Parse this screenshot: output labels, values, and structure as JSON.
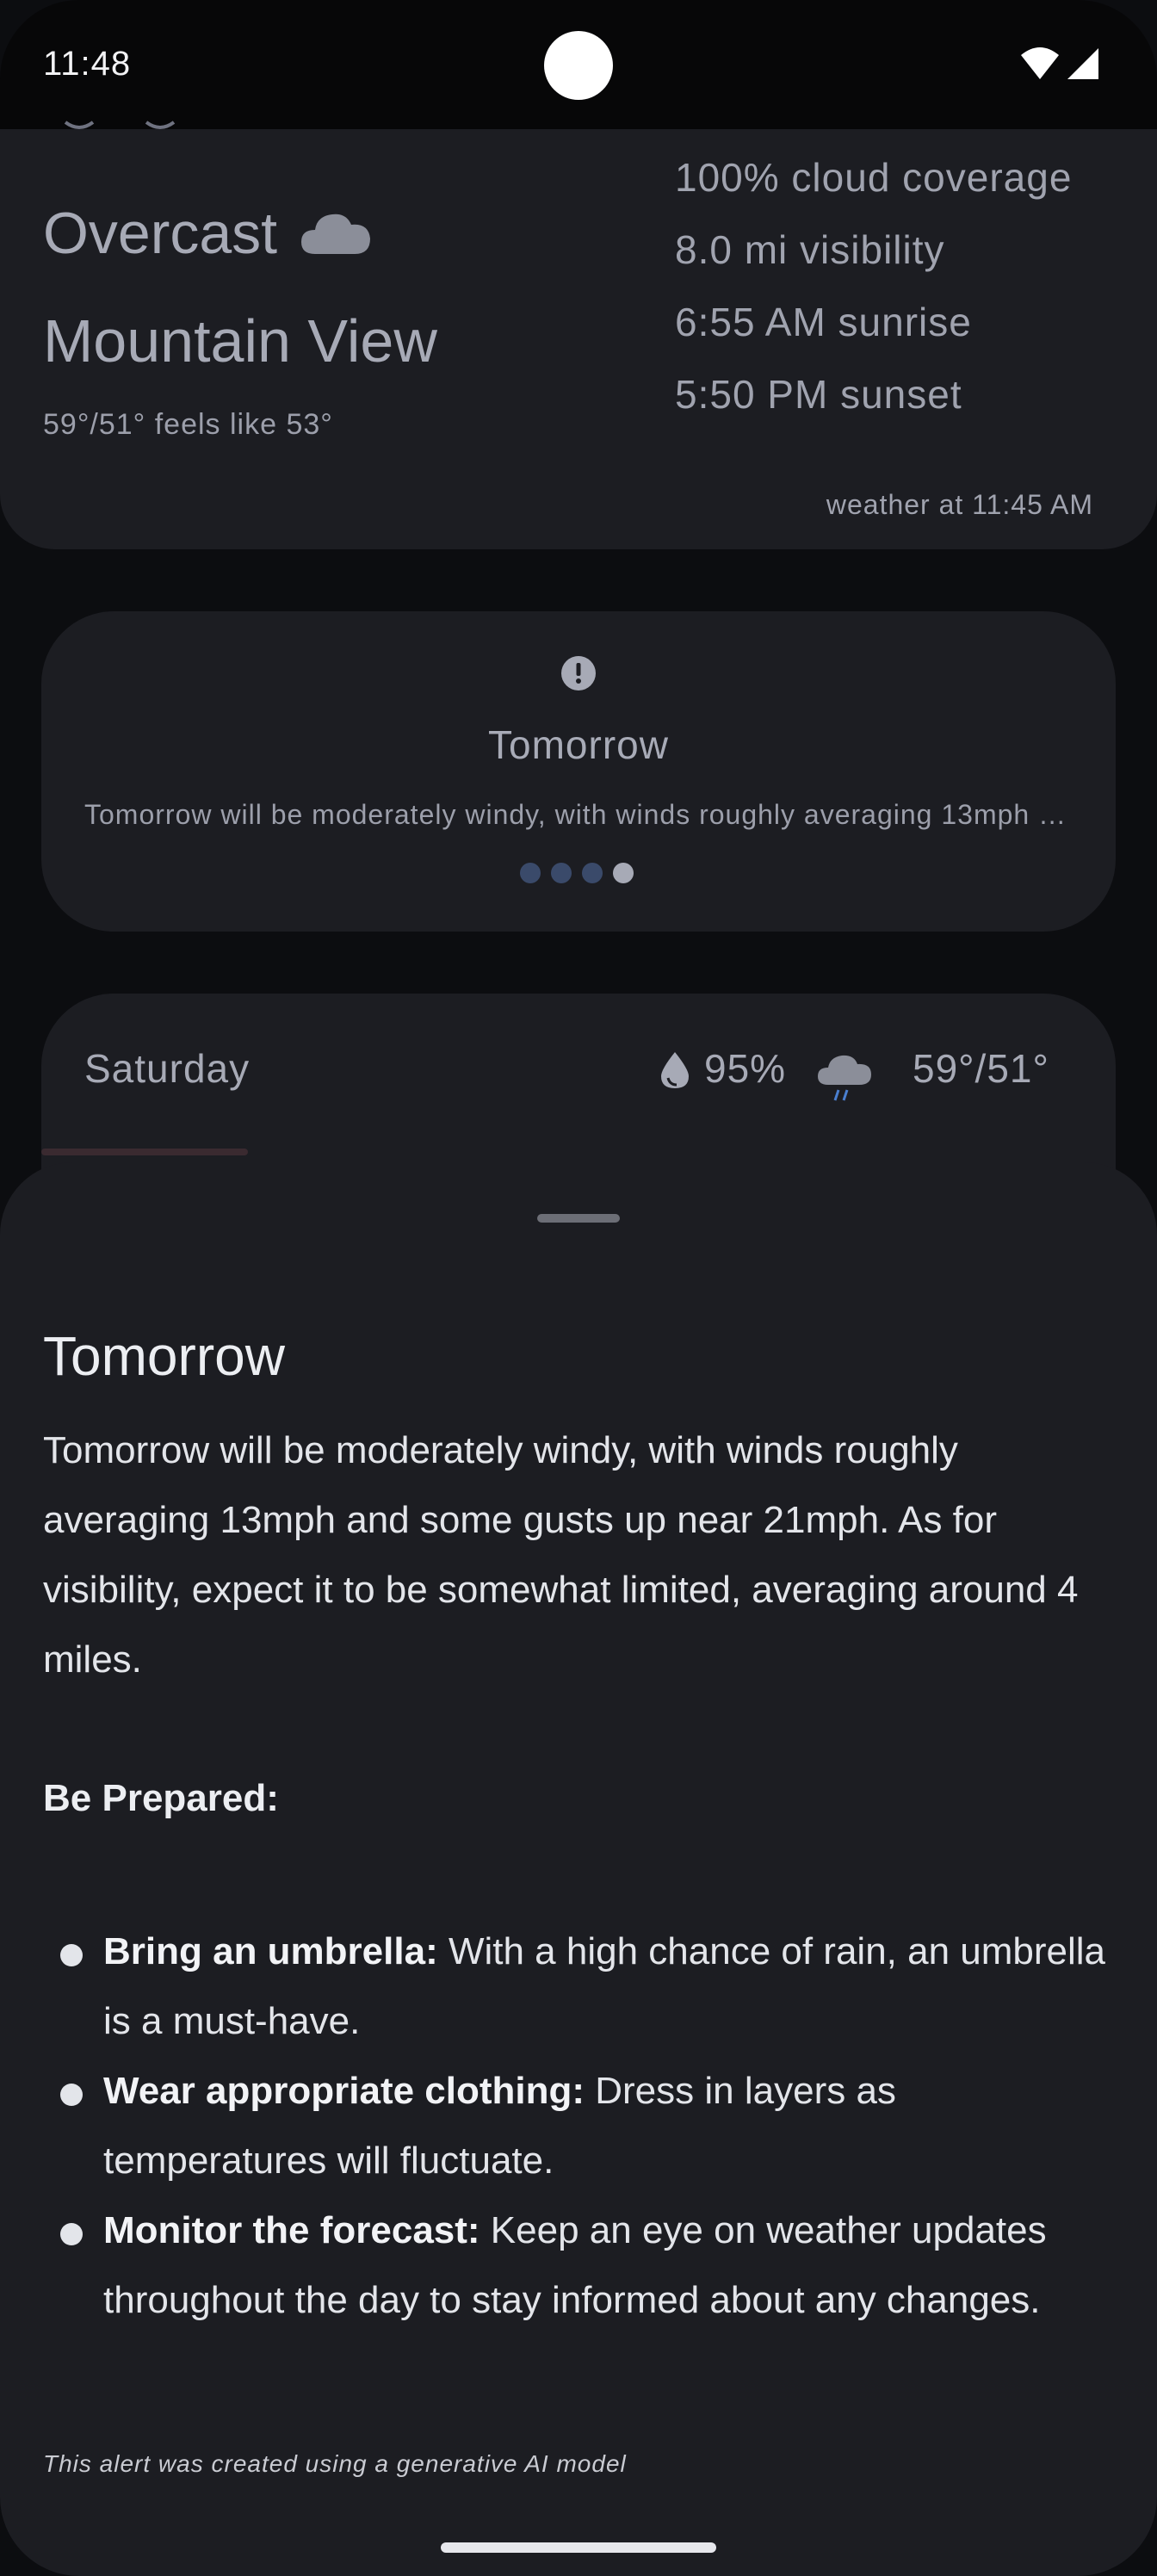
{
  "status_bar": {
    "time": "11:48",
    "icons": [
      "wifi-icon",
      "cellular-signal-icon"
    ]
  },
  "current_weather": {
    "condition": "Overcast",
    "condition_icon": "cloud-icon",
    "city": "Mountain View",
    "temps": "59°/51° feels like 53°",
    "details": [
      "100% cloud coverage",
      "8.0 mi visibility",
      "6:55 AM sunrise",
      "5:50 PM sunset"
    ],
    "updated": "weather at 11:45 AM"
  },
  "alert_card": {
    "icon": "alert-icon",
    "title": "Tomorrow",
    "text": "Tomorrow will be moderately windy, with winds roughly averaging 13mph and some gusts up near 21mph. As for visibility, expect it to be somewhat limited, averaging around 4 miles.",
    "page_count": 4,
    "active_page": 4
  },
  "daily_forecast": {
    "day": "Saturday",
    "precip_icon": "water-drop-icon",
    "precip": "95%",
    "weather_icon": "rain-cloud-icon",
    "temps": "59°/51°"
  },
  "sheet": {
    "title": "Tomorrow",
    "body": "Tomorrow will be moderately windy, with winds roughly averaging 13mph and some gusts up near 21mph. As for visibility, expect it to be somewhat limited, averaging around 4 miles.",
    "prepared_heading": "Be Prepared:",
    "bullets": [
      {
        "bold": "Bring an umbrella:",
        "text": " With a high chance of rain, an umbrella is a must-have."
      },
      {
        "bold": "Wear appropriate clothing:",
        "text": " Dress in layers as temperatures will fluctuate."
      },
      {
        "bold": "Monitor the forecast:",
        "text": " Keep an eye on weather updates throughout the day to stay informed about any changes."
      }
    ],
    "disclaimer": "This alert was created using a generative AI model"
  },
  "colors": {
    "surface": "#1c1d22",
    "background": "#0c0d10",
    "dot_inactive": "#3a4a6a"
  }
}
